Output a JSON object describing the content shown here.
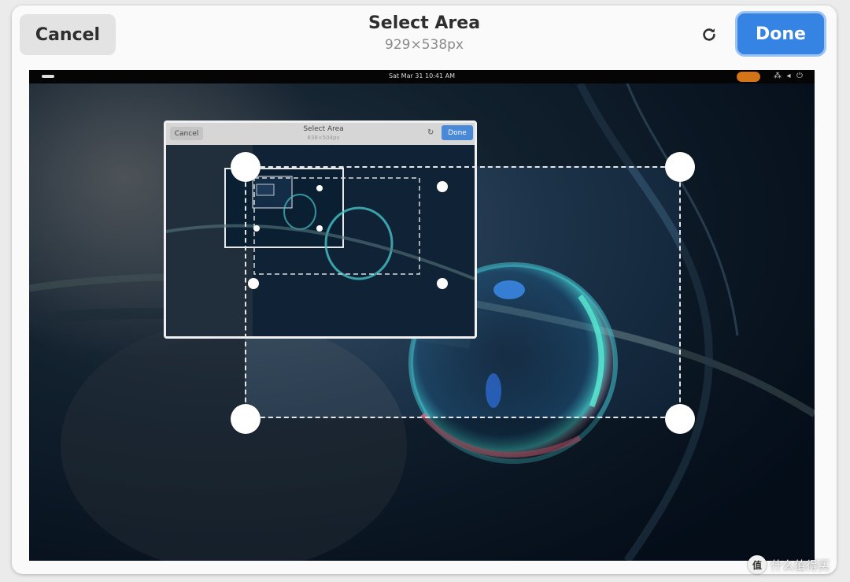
{
  "header": {
    "cancel_label": "Cancel",
    "title": "Select Area",
    "dimensions": "929×538px",
    "refresh_icon": "refresh-icon",
    "done_label": "Done"
  },
  "preview": {
    "clock": "Sat Mar 31  10:41 AM",
    "status_icons": [
      "network-icon",
      "volume-icon",
      "power-icon"
    ],
    "nested_window": {
      "cancel_label": "Cancel",
      "title": "Select Area",
      "dimensions": "838×504px",
      "done_label": "Done"
    }
  },
  "watermark": {
    "text": "什么值得买",
    "logo": "值"
  },
  "colors": {
    "accent": "#3584e4",
    "header_bg": "#fafafa",
    "record_indicator": "#d47419"
  }
}
